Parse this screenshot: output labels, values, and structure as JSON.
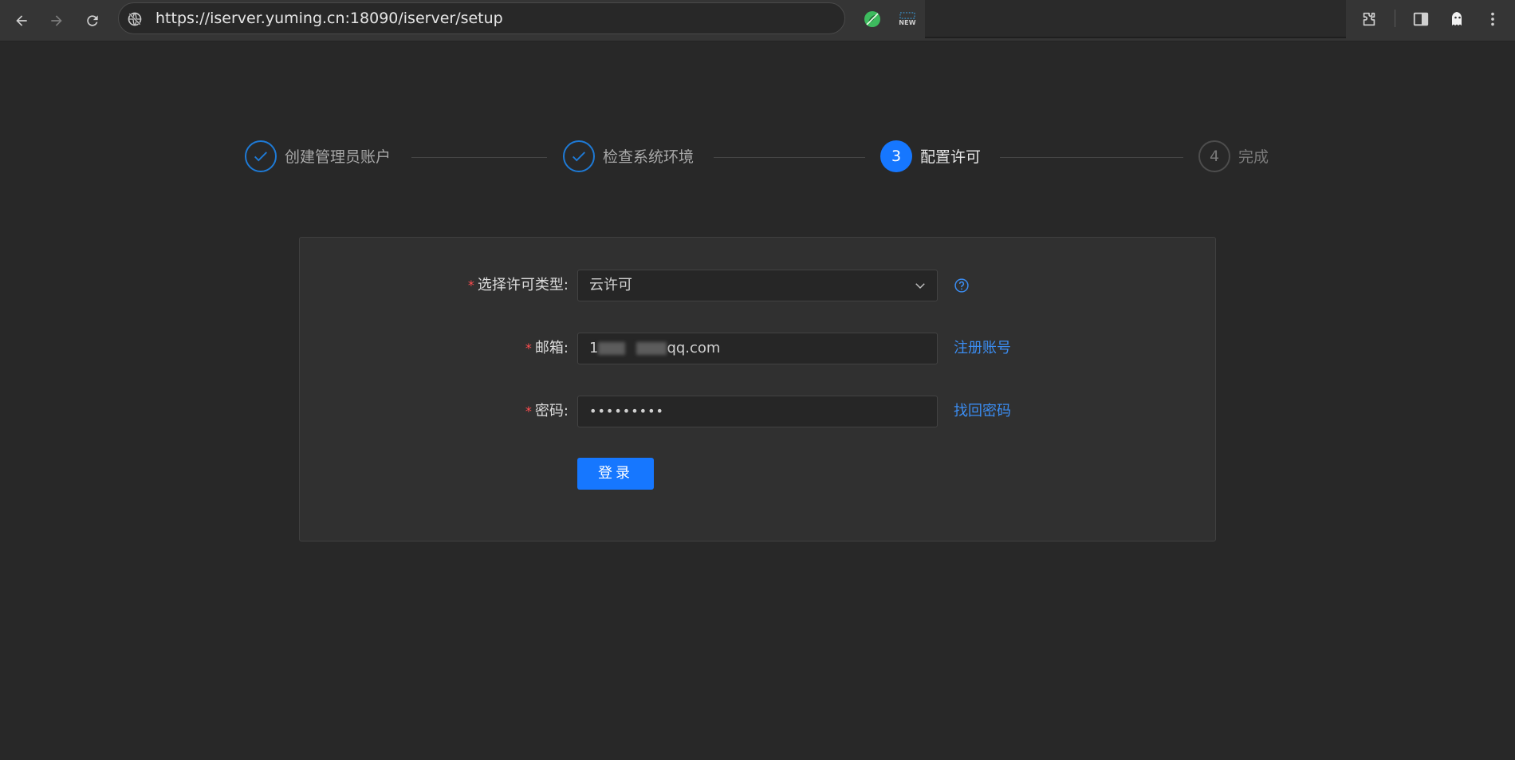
{
  "browser": {
    "url": "https://iserver.yuming.cn:18090/iserver/setup",
    "icons": {
      "back": "arrow-left-icon",
      "forward": "arrow-right-icon",
      "reload": "reload-icon",
      "site_info": "site-info-icon",
      "extension_green": "green-extension-icon",
      "extension_new": "new-badge-extension-icon",
      "extensions": "puzzle-icon",
      "side_panel": "side-panel-icon",
      "profile": "profile-ghost-icon",
      "menu": "more-vert-icon"
    },
    "new_badge_text": "NEW"
  },
  "steps": [
    {
      "title": "创建管理员账户",
      "status": "done"
    },
    {
      "title": "检查系统环境",
      "status": "done"
    },
    {
      "number": "3",
      "title": "配置许可",
      "status": "active"
    },
    {
      "number": "4",
      "title": "完成",
      "status": "pending"
    }
  ],
  "form": {
    "license_type": {
      "required_mark": "*",
      "label": "选择许可类型:",
      "value": "云许可"
    },
    "email": {
      "required_mark": "*",
      "label": "邮箱:",
      "value_prefix": "1",
      "value_suffix": "qq.com",
      "link": "注册账号"
    },
    "password": {
      "required_mark": "*",
      "label": "密码:",
      "value": "•••••••••",
      "link": "找回密码"
    },
    "submit_label": "登录"
  },
  "colors": {
    "page_bg": "#282828",
    "accent": "#1677ff",
    "link": "#3b8df2",
    "required": "#ff4d4f"
  }
}
